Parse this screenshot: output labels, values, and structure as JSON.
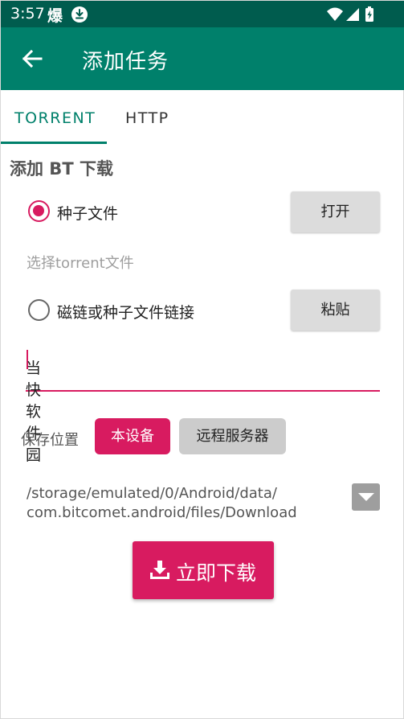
{
  "status_bar": {
    "time": "3:57",
    "notification_char": "爆",
    "icons": [
      "download-icon",
      "wifi-icon",
      "signal-icon",
      "battery-icon"
    ]
  },
  "app_bar": {
    "title": "添加任务",
    "back_icon": "arrow-left-icon"
  },
  "tabs": [
    {
      "label": "TORRENT",
      "selected": true
    },
    {
      "label": "HTTP",
      "selected": false
    }
  ],
  "section": {
    "title": "添加 BT 下载"
  },
  "options": [
    {
      "label": "种子文件",
      "checked": true,
      "button": "打开"
    },
    {
      "label": "磁链或种子文件链接",
      "checked": false,
      "button": "粘贴"
    }
  ],
  "torrent_hint": "选择torrent文件",
  "link_input": {
    "value": "当快软件园"
  },
  "save_location": {
    "label": "保存位置",
    "options": [
      {
        "label": "本设备",
        "selected": true
      },
      {
        "label": "远程服务器",
        "selected": false
      }
    ],
    "path_line1": "/storage/emulated/0/Android/data/",
    "path_line2": "com.bitcomet.android/files/Download"
  },
  "download_button": {
    "label": "立即下载",
    "icon": "download-tray-icon"
  },
  "colors": {
    "status_bar": "#005c4e",
    "primary": "#00806b",
    "accent": "#d81b60"
  }
}
